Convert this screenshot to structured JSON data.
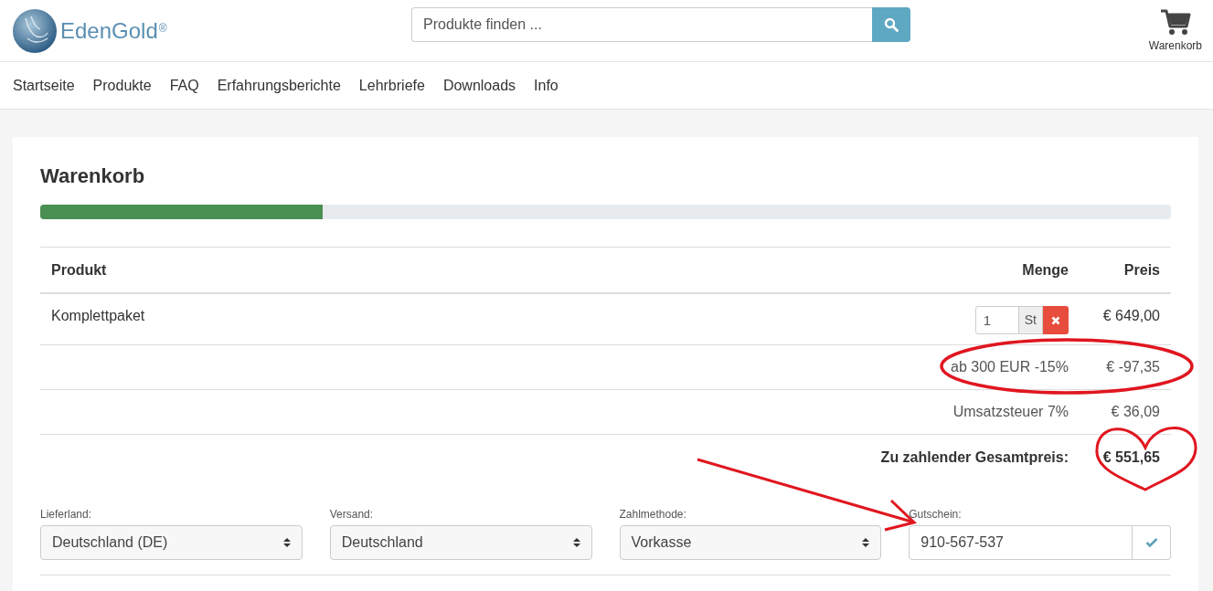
{
  "header": {
    "logo": {
      "name": "EdenGold",
      "mark": "®"
    },
    "search": {
      "placeholder": "Produkte finden ..."
    },
    "cart": {
      "label": "Warenkorb"
    }
  },
  "nav": [
    {
      "label": "Startseite"
    },
    {
      "label": "Produkte"
    },
    {
      "label": "FAQ"
    },
    {
      "label": "Erfahrungsberichte"
    },
    {
      "label": "Lehrbriefe"
    },
    {
      "label": "Downloads"
    },
    {
      "label": "Info"
    }
  ],
  "cart": {
    "title": "Warenkorb",
    "progress": {
      "level": 0.25
    },
    "table": {
      "columns": [
        "Produkt",
        "Menge",
        "Preis"
      ],
      "items": [
        {
          "product": "Komplettpaket",
          "quantity": "1",
          "unit": "St",
          "price": "€ 649,00"
        }
      ],
      "summary": [
        {
          "kind": "normal",
          "label": "ab 300 EUR -15%",
          "amount": "€ -97,35"
        },
        {
          "kind": "normal",
          "label": "Umsatzsteuer 7%",
          "amount": "€ 36,09"
        },
        {
          "kind": "total",
          "label": "Zu zahlender Gesamtpreis:",
          "amount": "€ 551,65"
        }
      ]
    },
    "fields": [
      {
        "kind": "select",
        "label": "Lieferland:",
        "value": "Deutschland (DE)"
      },
      {
        "kind": "select",
        "label": "Versand:",
        "value": "Deutschland"
      },
      {
        "kind": "select",
        "label": "Zahlmethode:",
        "value": "Vorkasse"
      },
      {
        "kind": "voucher",
        "label": "Gutschein:",
        "value": "910-567-537"
      }
    ]
  }
}
